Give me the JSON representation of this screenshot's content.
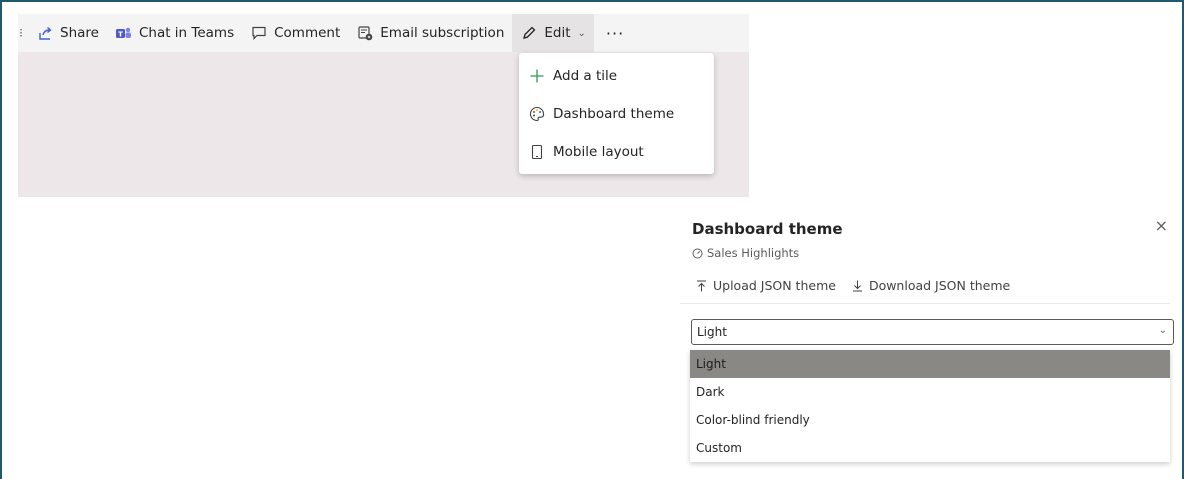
{
  "toolbar": {
    "items": [
      {
        "label": "Share",
        "icon": "share-icon"
      },
      {
        "label": "Chat in Teams",
        "icon": "teams-icon"
      },
      {
        "label": "Comment",
        "icon": "comment-icon"
      },
      {
        "label": "Email subscription",
        "icon": "email-subscription-icon"
      },
      {
        "label": "Edit",
        "icon": "pencil-icon"
      }
    ],
    "more_label": "···"
  },
  "edit_menu": {
    "items": [
      {
        "label": "Add a tile",
        "icon": "plus-icon"
      },
      {
        "label": "Dashboard theme",
        "icon": "palette-icon"
      },
      {
        "label": "Mobile layout",
        "icon": "phone-icon"
      }
    ]
  },
  "theme_panel": {
    "title": "Dashboard theme",
    "close_label": "×",
    "subtitle": "Sales Highlights",
    "upload_label": "Upload JSON theme",
    "download_label": "Download JSON theme",
    "selected_value": "Light",
    "options": [
      "Light",
      "Dark",
      "Color-blind friendly",
      "Custom"
    ]
  },
  "colors": {
    "accent_plus": "#2e9e4f",
    "selected_option": "#8a8885",
    "frame": "#1f5a6e"
  }
}
